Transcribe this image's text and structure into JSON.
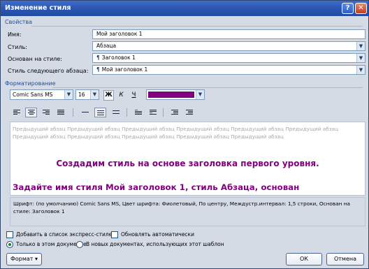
{
  "window": {
    "title": "Изменение стиля",
    "help_label": "?",
    "close_label": "✕"
  },
  "properties": {
    "header": "Свойства",
    "name_label": "Имя:",
    "name_value": "Мой заголовок 1",
    "type_label": "Стиль:",
    "type_value": "Абзаца",
    "based_on_label": "Основан на стиле:",
    "based_on_value": "Заголовок 1",
    "next_label": "Стиль следующего абзаца:",
    "next_value": "Мой заголовок 1"
  },
  "formatting": {
    "header": "Форматирование",
    "font_name": "Comic Sans MS",
    "font_size": "16",
    "bold_label": "Ж",
    "italic_label": "К",
    "underline_label": "Ч",
    "font_color": "#800080"
  },
  "preview": {
    "prev_paragraph": "Предыдущий абзац Предыдущий абзац Предыдущий абзац Предыдущий абзац Предыдущий абзац Предыдущий абзац Предыдущий абзац Предыдущий абзац Предыдущий абзац Предыдущий абзац Предыдущий абзац",
    "line1": "Создадим стиль на основе заголовка первого уровня.",
    "line2": "Задайте имя стиля Мой заголовок 1, стиль Абзаца, основан"
  },
  "description": "Шрифт: (по умолчанию) Comic Sans MS, Цвет шрифта: Фиолетовый, По центру, Междустр.интервал:  1,5 строки, Основан на стиле: Заголовок 1",
  "options": {
    "add_quick": "Добавить в список экспресс-стилей",
    "auto_update": "Обновлять автоматически",
    "only_doc": "Только в этом документе",
    "new_docs": "В новых документах, использующих этот шаблон"
  },
  "buttons": {
    "format": "Формат",
    "ok": "ОК",
    "cancel": "Отмена"
  }
}
